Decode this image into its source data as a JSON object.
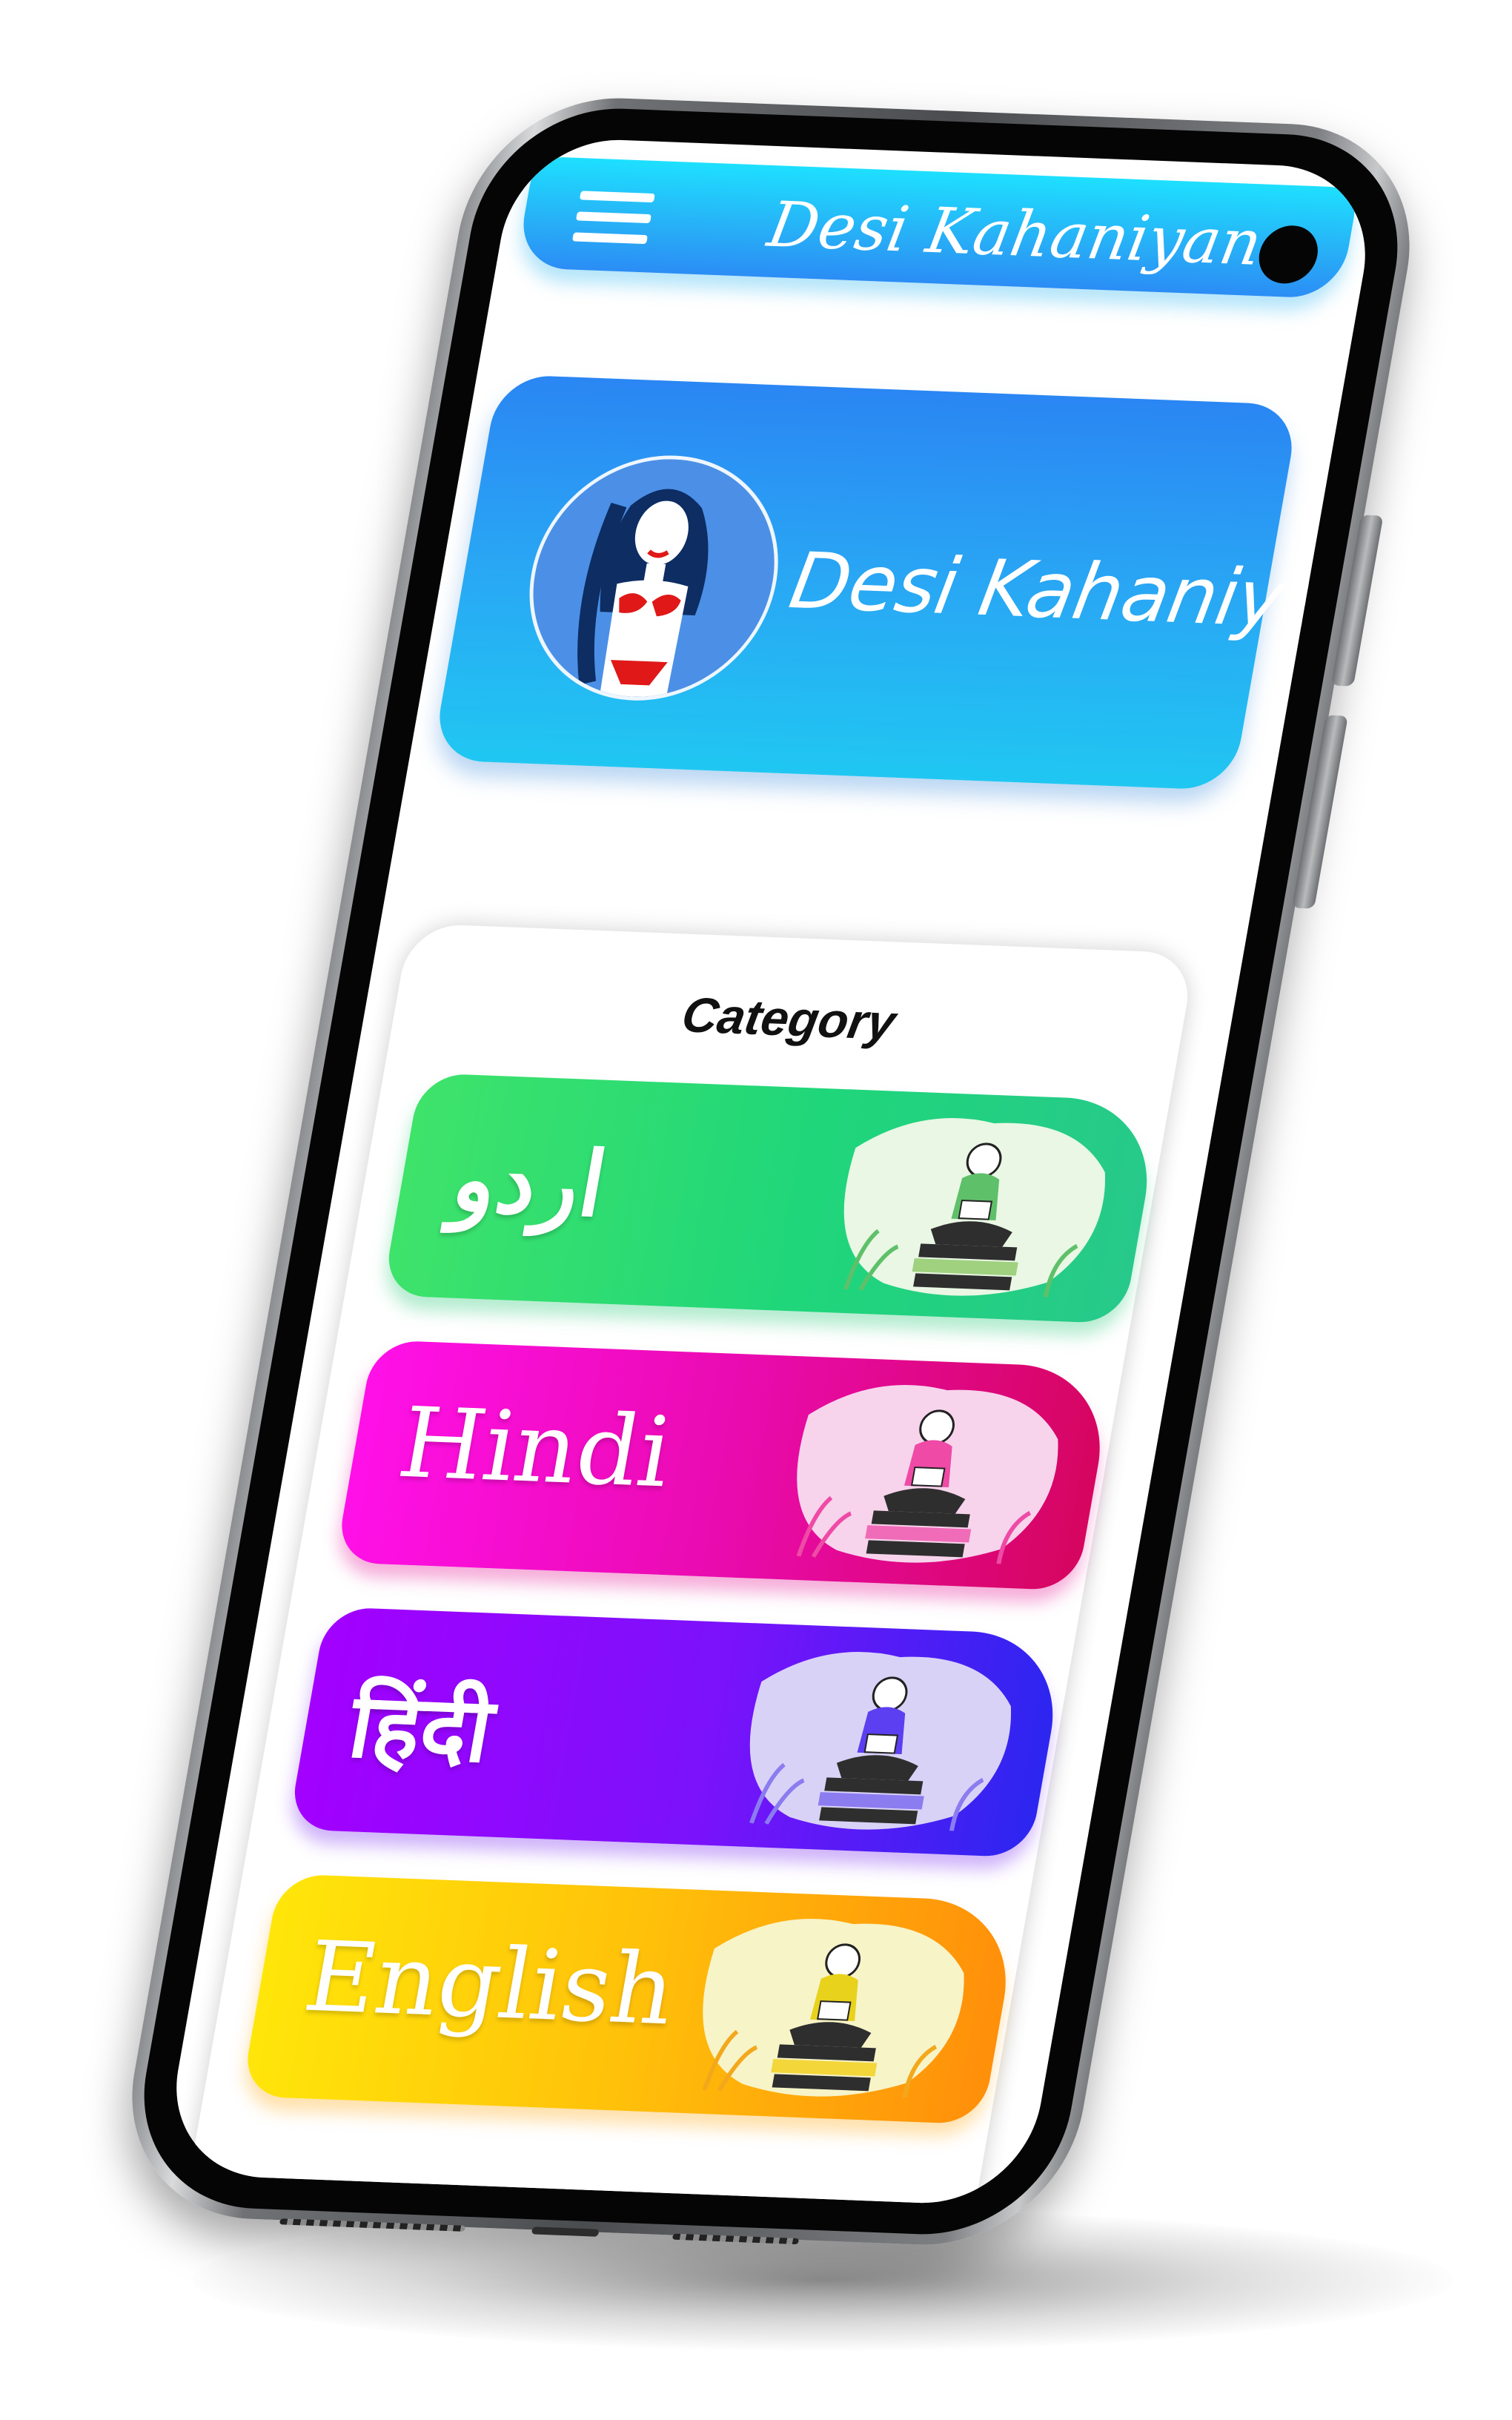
{
  "app_bar": {
    "title": "Desi Kahaniyan",
    "menu_icon": "hamburger-menu-icon"
  },
  "banner": {
    "title": "Desi Kahaniyan",
    "image": "woman-in-bikini-illustration"
  },
  "category": {
    "heading": "Category",
    "items": [
      {
        "label": "اردو",
        "colors": [
          "#3ee36a",
          "#27c98a"
        ],
        "art_tint": "#e9f7e4"
      },
      {
        "label": "Hindi",
        "colors": [
          "#ff10e8",
          "#d6055f"
        ],
        "art_tint": "#f7d4ec"
      },
      {
        "label": "हिंदी",
        "colors": [
          "#a300ff",
          "#2c26f0"
        ],
        "art_tint": "#d9d2f7"
      },
      {
        "label": "English",
        "colors": [
          "#ffe60a",
          "#ff8f0a"
        ],
        "art_tint": "#f7f4c8"
      }
    ],
    "art_icon": "girl-reading-on-books-illustration"
  },
  "colors": {
    "app_bar": "#27b2f7",
    "banner": "#29a7f4"
  }
}
